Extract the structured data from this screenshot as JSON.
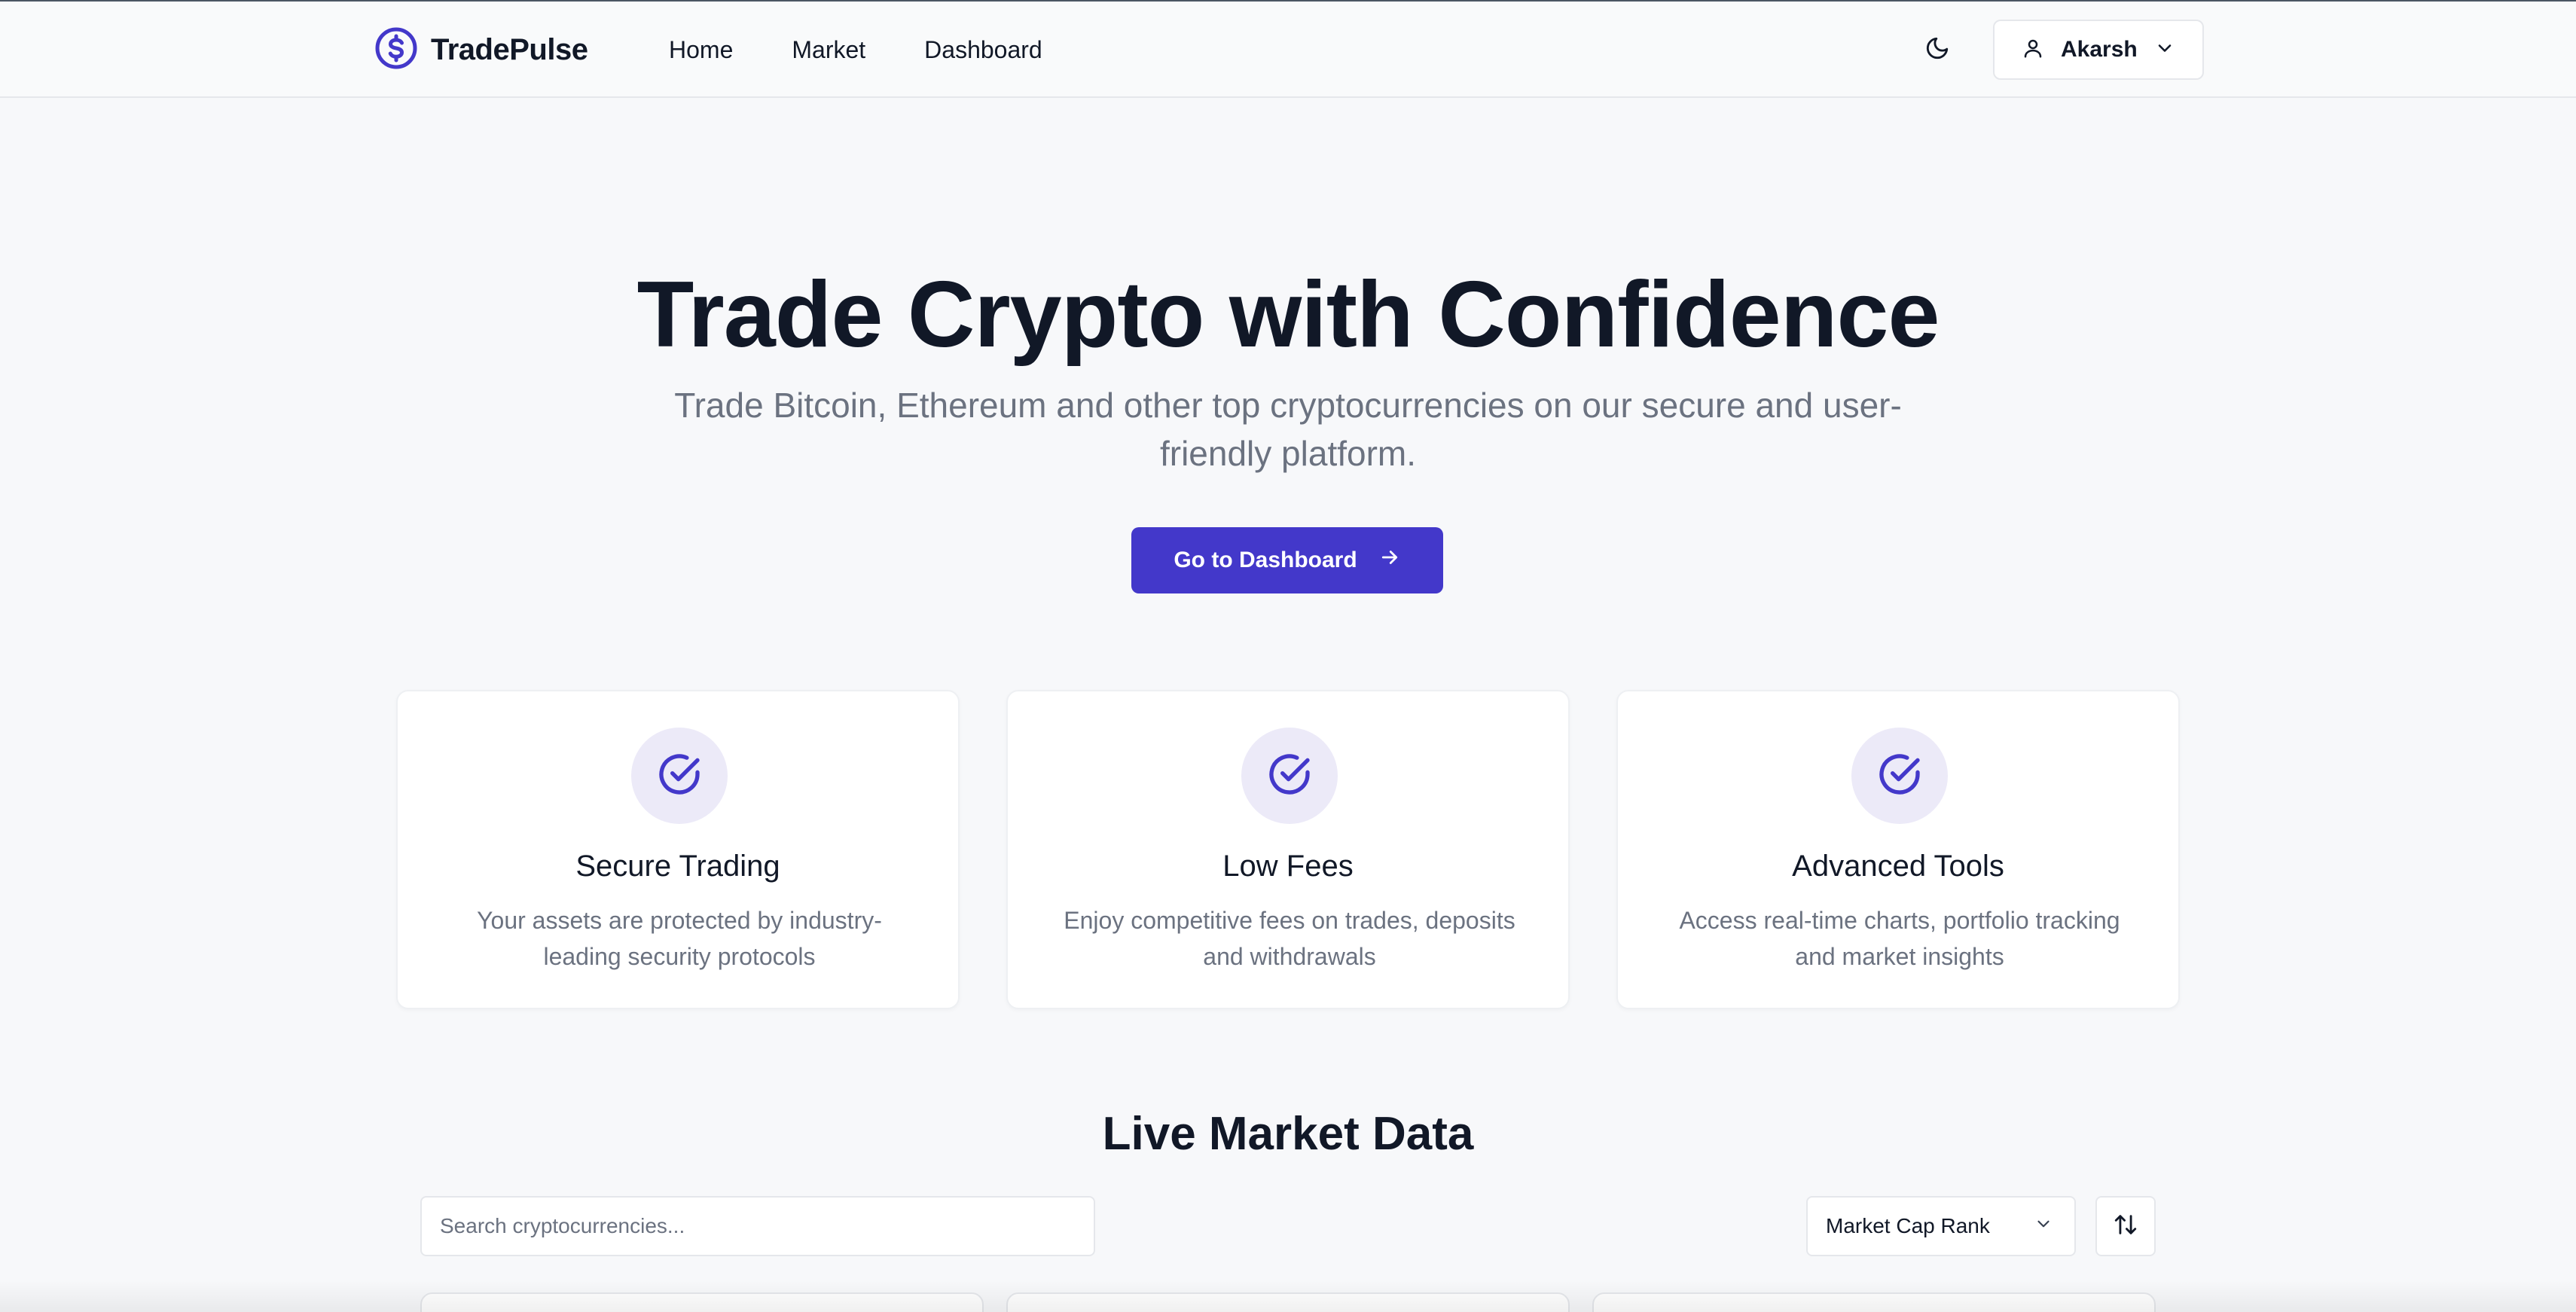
{
  "header": {
    "brand": "TradePulse",
    "nav": [
      "Home",
      "Market",
      "Dashboard"
    ],
    "user": {
      "name": "Akarsh"
    }
  },
  "hero": {
    "title": "Trade Crypto with Confidence",
    "subtitle": "Trade Bitcoin, Ethereum and other top cryptocurrencies on our secure and user-friendly platform.",
    "cta_label": "Go to Dashboard"
  },
  "features": [
    {
      "title": "Secure Trading",
      "description": "Your assets are protected by industry-leading security protocols"
    },
    {
      "title": "Low Fees",
      "description": "Enjoy competitive fees on trades, deposits and withdrawals"
    },
    {
      "title": "Advanced Tools",
      "description": "Access real-time charts, portfolio tracking and market insights"
    }
  ],
  "market": {
    "title": "Live Market Data",
    "search_placeholder": "Search cryptocurrencies...",
    "sort_selected": "Market Cap Rank"
  },
  "colors": {
    "accent": "#4338ca",
    "icon_bg": "#eceaf8",
    "text_muted": "#6b7280"
  },
  "icons": {
    "brand": "dollar-circle-icon",
    "theme": "moon-icon",
    "user": "user-icon",
    "dropdown": "chevron-down-icon",
    "cta": "arrow-right-icon",
    "feature": "check-circle-icon",
    "sort": "sort-arrows-icon"
  }
}
